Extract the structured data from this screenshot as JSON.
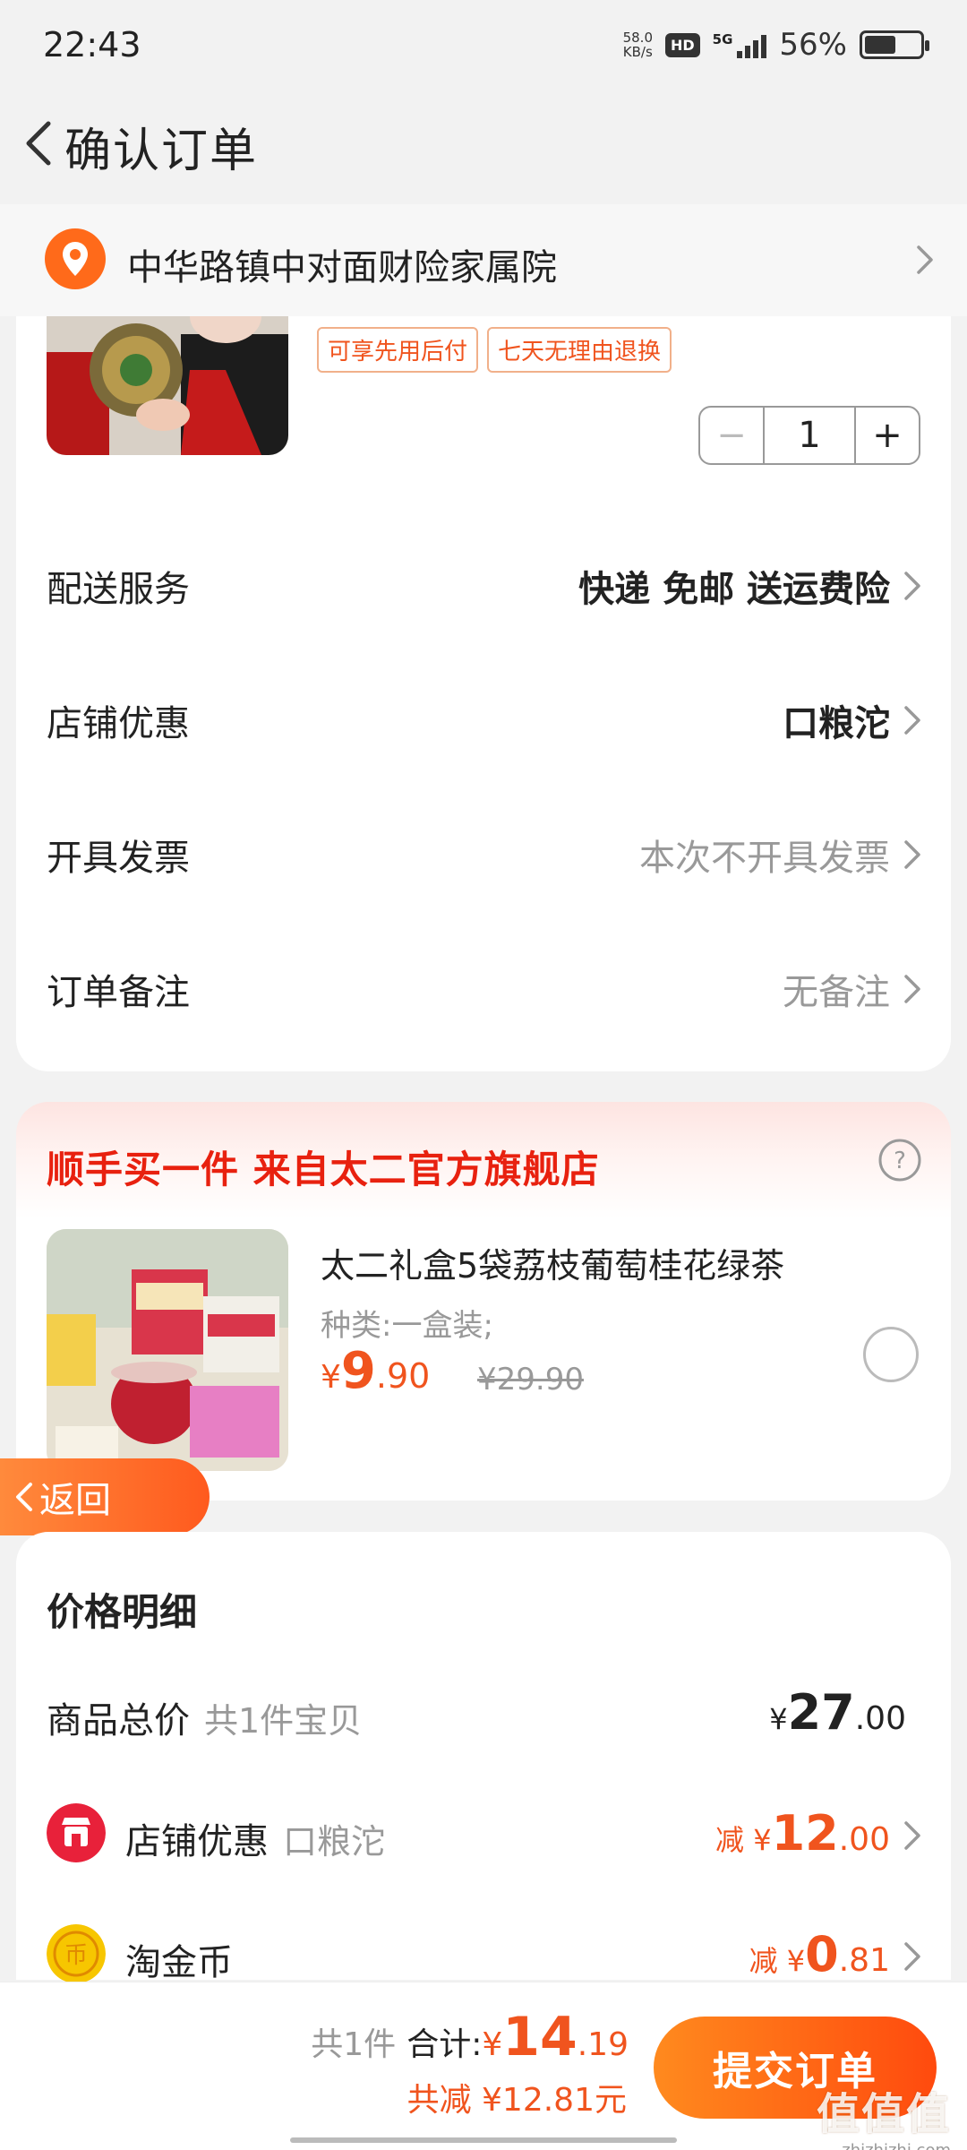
{
  "status_bar": {
    "time": "22:43",
    "net_speed_value": "58.0",
    "net_speed_unit": "KB/s",
    "hd_badge": "HD",
    "network": "5G",
    "battery_pct": "56%",
    "battery_level": 0.56
  },
  "header": {
    "title": "确认订单"
  },
  "address": {
    "text": "中华路镇中对面财险家属院"
  },
  "product": {
    "tags": [
      "可享先用后付",
      "七天无理由退换"
    ],
    "quantity": "1",
    "minus_label": "−",
    "plus_label": "+"
  },
  "order_rows": [
    {
      "label": "配送服务",
      "value": "快递 免邮 送运费险"
    },
    {
      "label": "店铺优惠",
      "value": "口粮沱"
    },
    {
      "label": "开具发票",
      "value": "本次不开具发票"
    },
    {
      "label": "订单备注",
      "value": "无备注"
    }
  ],
  "addon": {
    "header": "顺手买一件  来自太二官方旗舰店",
    "title": "太二礼盒5袋荔枝葡萄桂花绿茶",
    "spec": "种类:一盒装;",
    "price_currency": "¥",
    "price_int": "9",
    "price_dec": ".90",
    "original_price": "¥29.90"
  },
  "float_back": {
    "label": "返回"
  },
  "price_detail": {
    "title": "价格明细",
    "goods_total": {
      "label": "商品总价",
      "sub": "共1件宝贝",
      "currency": "¥",
      "int": "27",
      "dec": ".00"
    },
    "shop_discount": {
      "label": "店铺优惠",
      "sub": "口粮沱",
      "prefix": "减 ¥",
      "int": "12",
      "dec": ".00"
    },
    "taojinbi": {
      "label": "淘金币",
      "prefix": "减 ¥",
      "int": "0",
      "dec": ".81"
    }
  },
  "bottom_bar": {
    "count": "共1件",
    "total_label": "合计:",
    "total_currency": "¥",
    "total_int": "14",
    "total_dec": ".19",
    "saved": "共减 ¥12.81元",
    "submit_label": "提交订单"
  },
  "watermark": {
    "big": "值值值",
    "small": "zhizhizhi.com"
  },
  "colors": {
    "accent": "#f0541e",
    "red": "#e8210f",
    "gray": "#999999"
  }
}
